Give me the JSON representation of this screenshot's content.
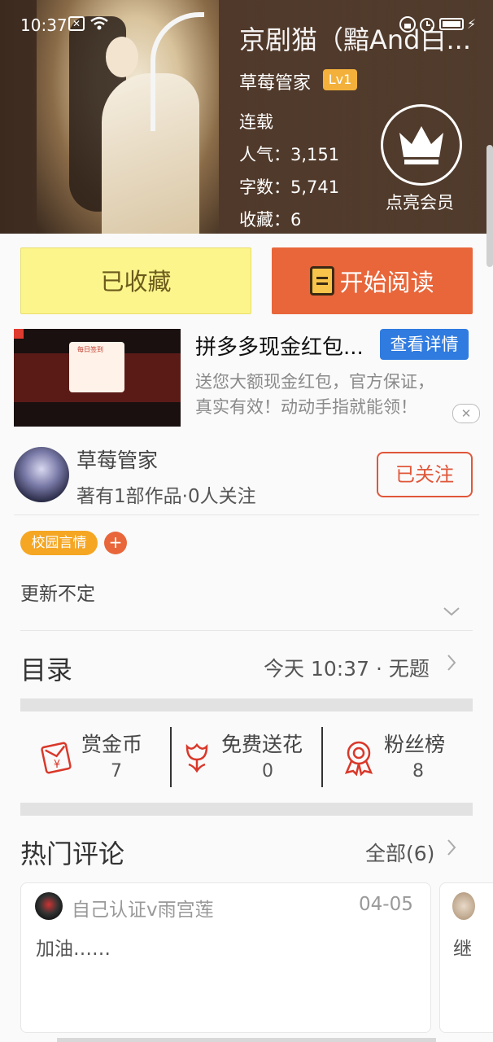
{
  "status_bar": {
    "time": "10:37"
  },
  "book": {
    "title": "京剧猫（黯And白...",
    "author": "草莓管家",
    "level": "Lv1",
    "status": "连载",
    "popularity": "人气：3,151",
    "word_count": "字数：5,741",
    "collections": "收藏：6",
    "member_label": "点亮会员"
  },
  "actions": {
    "favorited_label": "已收藏",
    "start_reading_label": "开始阅读"
  },
  "ad": {
    "title": "拼多多现金红包...",
    "detail_button": "查看详情",
    "desc_line1": "送您大额现金红包，官方保证，",
    "desc_line2": "真实有效！动动手指就能领！",
    "image_caption": "每日签到",
    "close": "✕"
  },
  "author_row": {
    "name": "草莓管家",
    "meta": "著有1部作品·0人关注",
    "follow_label": "已关注"
  },
  "tags": {
    "items": [
      "校园言情"
    ],
    "add": "+"
  },
  "update_schedule": "更新不定",
  "toc": {
    "label": "目录",
    "latest": "今天 10:37 · 无题"
  },
  "stats": [
    {
      "label": "赏金币",
      "value": "7",
      "icon": "red-envelope-icon"
    },
    {
      "label": "免费送花",
      "value": "0",
      "icon": "flower-icon"
    },
    {
      "label": "粉丝榜",
      "value": "8",
      "icon": "award-ribbon-icon"
    }
  ],
  "comments": {
    "label": "热门评论",
    "all_label": "全部(6)",
    "items": [
      {
        "user": "自己认证v雨宫莲",
        "date": "04-05",
        "text": "加油……"
      },
      {
        "text": "继"
      }
    ]
  },
  "colors": {
    "accent": "#e8663a",
    "favorite_bg": "#fcf58c",
    "link_blue": "#2f7be0",
    "tag_orange": "#f5a623"
  }
}
